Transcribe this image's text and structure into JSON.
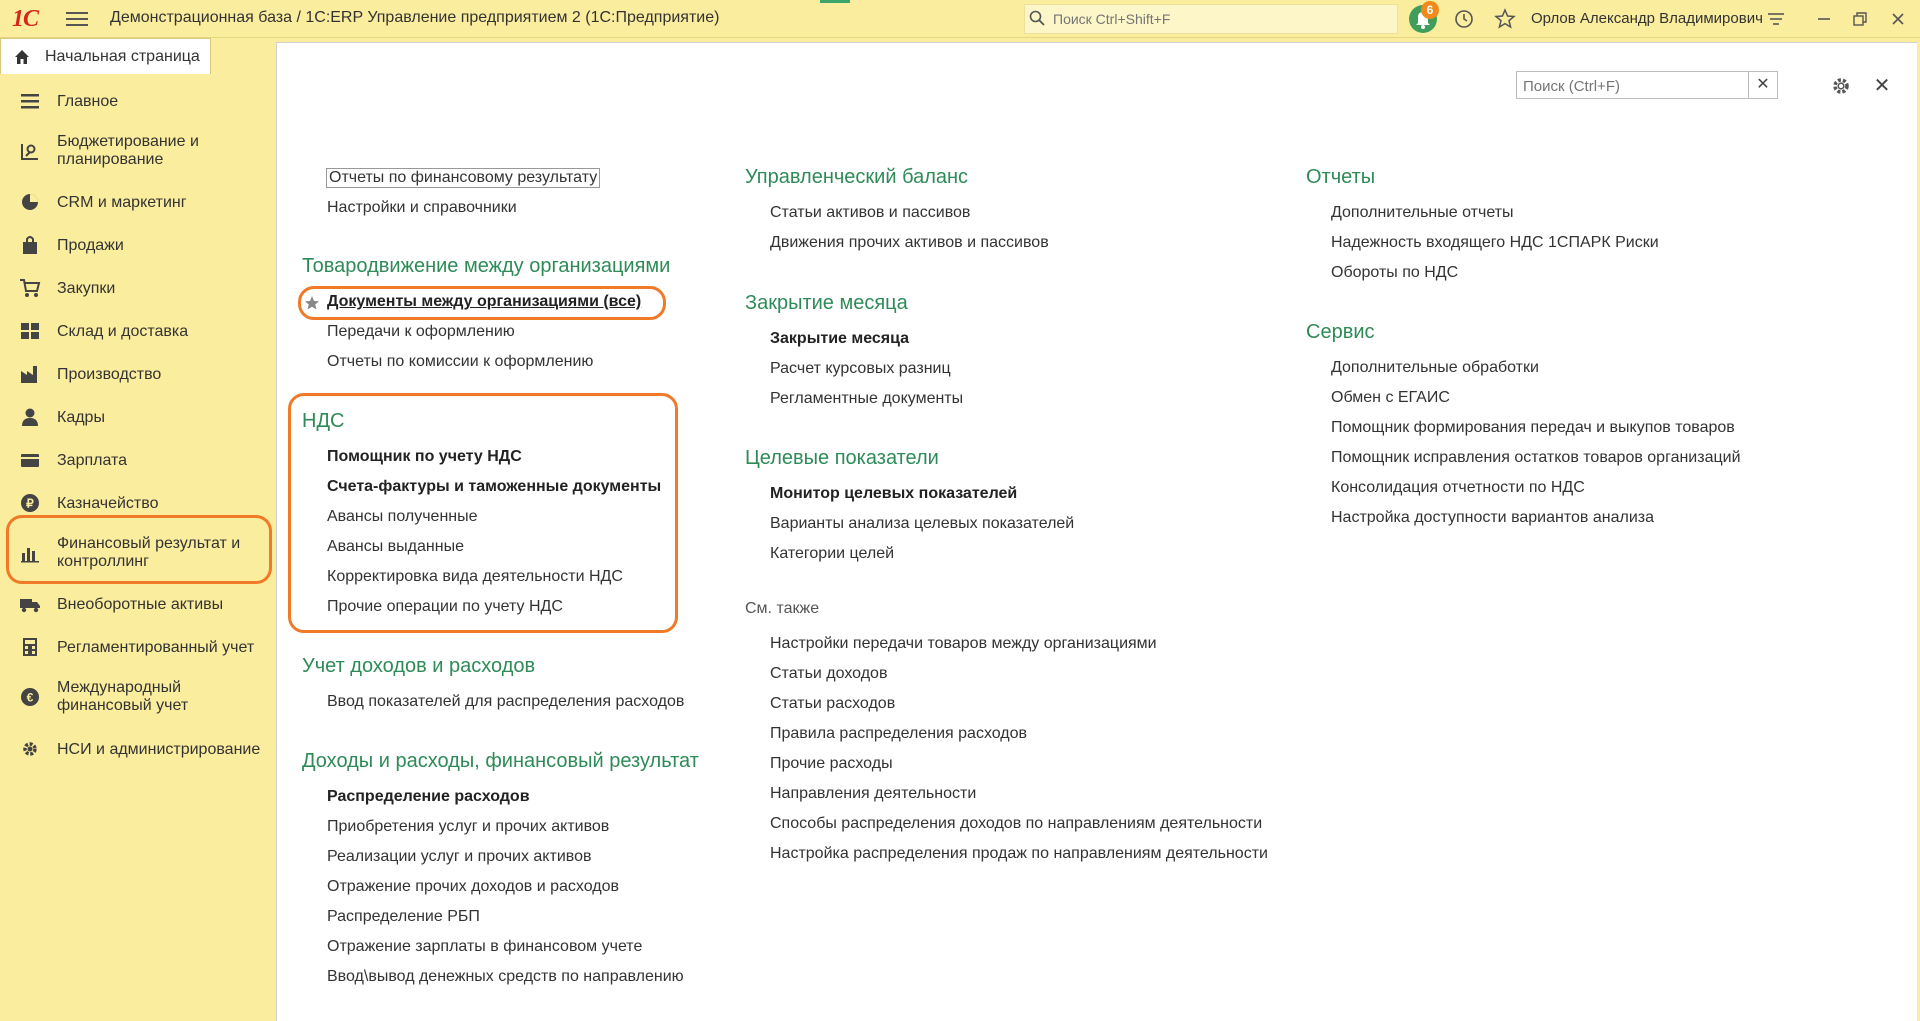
{
  "app": {
    "title": "Демонстрационная база / 1С:ERP Управление предприятием 2  (1С:Предприятие)",
    "logo_text": "1С",
    "search_placeholder": "Поиск Ctrl+Shift+F",
    "notifications_count": "6",
    "user_name": "Орлов Александр Владимирович"
  },
  "home_tab": {
    "label": "Начальная страница"
  },
  "sidebar": {
    "items": [
      {
        "label": "Главное",
        "icon": "list-icon"
      },
      {
        "label": "Бюджетирование и планирование",
        "icon": "budget-icon"
      },
      {
        "label": "CRM и маркетинг",
        "icon": "pie-chart-icon"
      },
      {
        "label": "Продажи",
        "icon": "bag-icon"
      },
      {
        "label": "Закупки",
        "icon": "cart-icon"
      },
      {
        "label": "Склад и доставка",
        "icon": "warehouse-icon"
      },
      {
        "label": "Производство",
        "icon": "factory-icon"
      },
      {
        "label": "Кадры",
        "icon": "person-icon"
      },
      {
        "label": "Зарплата",
        "icon": "wallet-icon"
      },
      {
        "label": "Казначейство",
        "icon": "coin-icon"
      },
      {
        "label": "Финансовый результат и контроллинг",
        "icon": "bar-chart-icon",
        "active": true
      },
      {
        "label": "Внеоборотные активы",
        "icon": "truck-icon"
      },
      {
        "label": "Регламентированный учет",
        "icon": "calculator-icon"
      },
      {
        "label": "Международный финансовый учет",
        "icon": "globe-icon"
      },
      {
        "label": "НСИ и администрирование",
        "icon": "gear-icon"
      }
    ]
  },
  "main": {
    "search_placeholder": "Поиск (Ctrl+F)",
    "col1": {
      "top_links": [
        "Отчеты по финансовому результату",
        "Настройки и справочники"
      ],
      "tovar": {
        "header": "Товародвижение между организациями",
        "links": [
          "Документы между организациями (все)",
          "Передачи к оформлению",
          "Отчеты по комиссии к оформлению"
        ]
      },
      "nds": {
        "header": "НДС",
        "links": [
          "Помощник по учету НДС",
          "Счета-фактуры и таможенные документы",
          "Авансы полученные",
          "Авансы выданные",
          "Корректировка вида деятельности НДС",
          "Прочие операции по учету НДС"
        ]
      },
      "uchet": {
        "header": "Учет доходов и расходов",
        "links": [
          "Ввод показателей для распределения расходов"
        ]
      },
      "dohody": {
        "header": "Доходы и расходы, финансовый результат",
        "links": [
          "Распределение расходов",
          "Приобретения услуг и прочих активов",
          "Реализации услуг и прочих активов",
          "Отражение прочих доходов и расходов",
          "Распределение РБП",
          "Отражение зарплаты в финансовом учете",
          "Ввод\\вывод денежных средств по направлению"
        ]
      }
    },
    "col2": {
      "balance": {
        "header": "Управленческий баланс",
        "links": [
          "Статьи активов и пассивов",
          "Движения прочих активов и пассивов"
        ]
      },
      "closing": {
        "header": "Закрытие месяца",
        "links": [
          "Закрытие месяца",
          "Расчет курсовых разниц",
          "Регламентные документы"
        ]
      },
      "targets": {
        "header": "Целевые показатели",
        "links": [
          "Монитор целевых показателей",
          "Варианты анализа целевых показателей",
          "Категории целей"
        ]
      },
      "see_also": {
        "header": "См. также",
        "links": [
          "Настройки передачи товаров между организациями",
          "Статьи доходов",
          "Статьи расходов",
          "Правила распределения расходов",
          "Прочие расходы",
          "Направления деятельности",
          "Способы распределения доходов по направлениям деятельности",
          "Настройка распределения продаж по направлениям деятельности"
        ]
      }
    },
    "col3": {
      "reports": {
        "header": "Отчеты",
        "links": [
          "Дополнительные отчеты",
          "Надежность входящего НДС 1СПАРК Риски",
          "Обороты по НДС"
        ]
      },
      "service": {
        "header": "Сервис",
        "links": [
          "Дополнительные обработки",
          "Обмен с ЕГАИС",
          "Помощник формирования передач и выкупов товаров",
          "Помощник исправления остатков товаров организаций",
          "Консолидация отчетности по НДС",
          "Настройка доступности вариантов анализа"
        ]
      }
    }
  },
  "colors": {
    "accent": "#2e8b57",
    "sidebar_bg": "#fbed9e",
    "highlight": "#f07a27"
  }
}
